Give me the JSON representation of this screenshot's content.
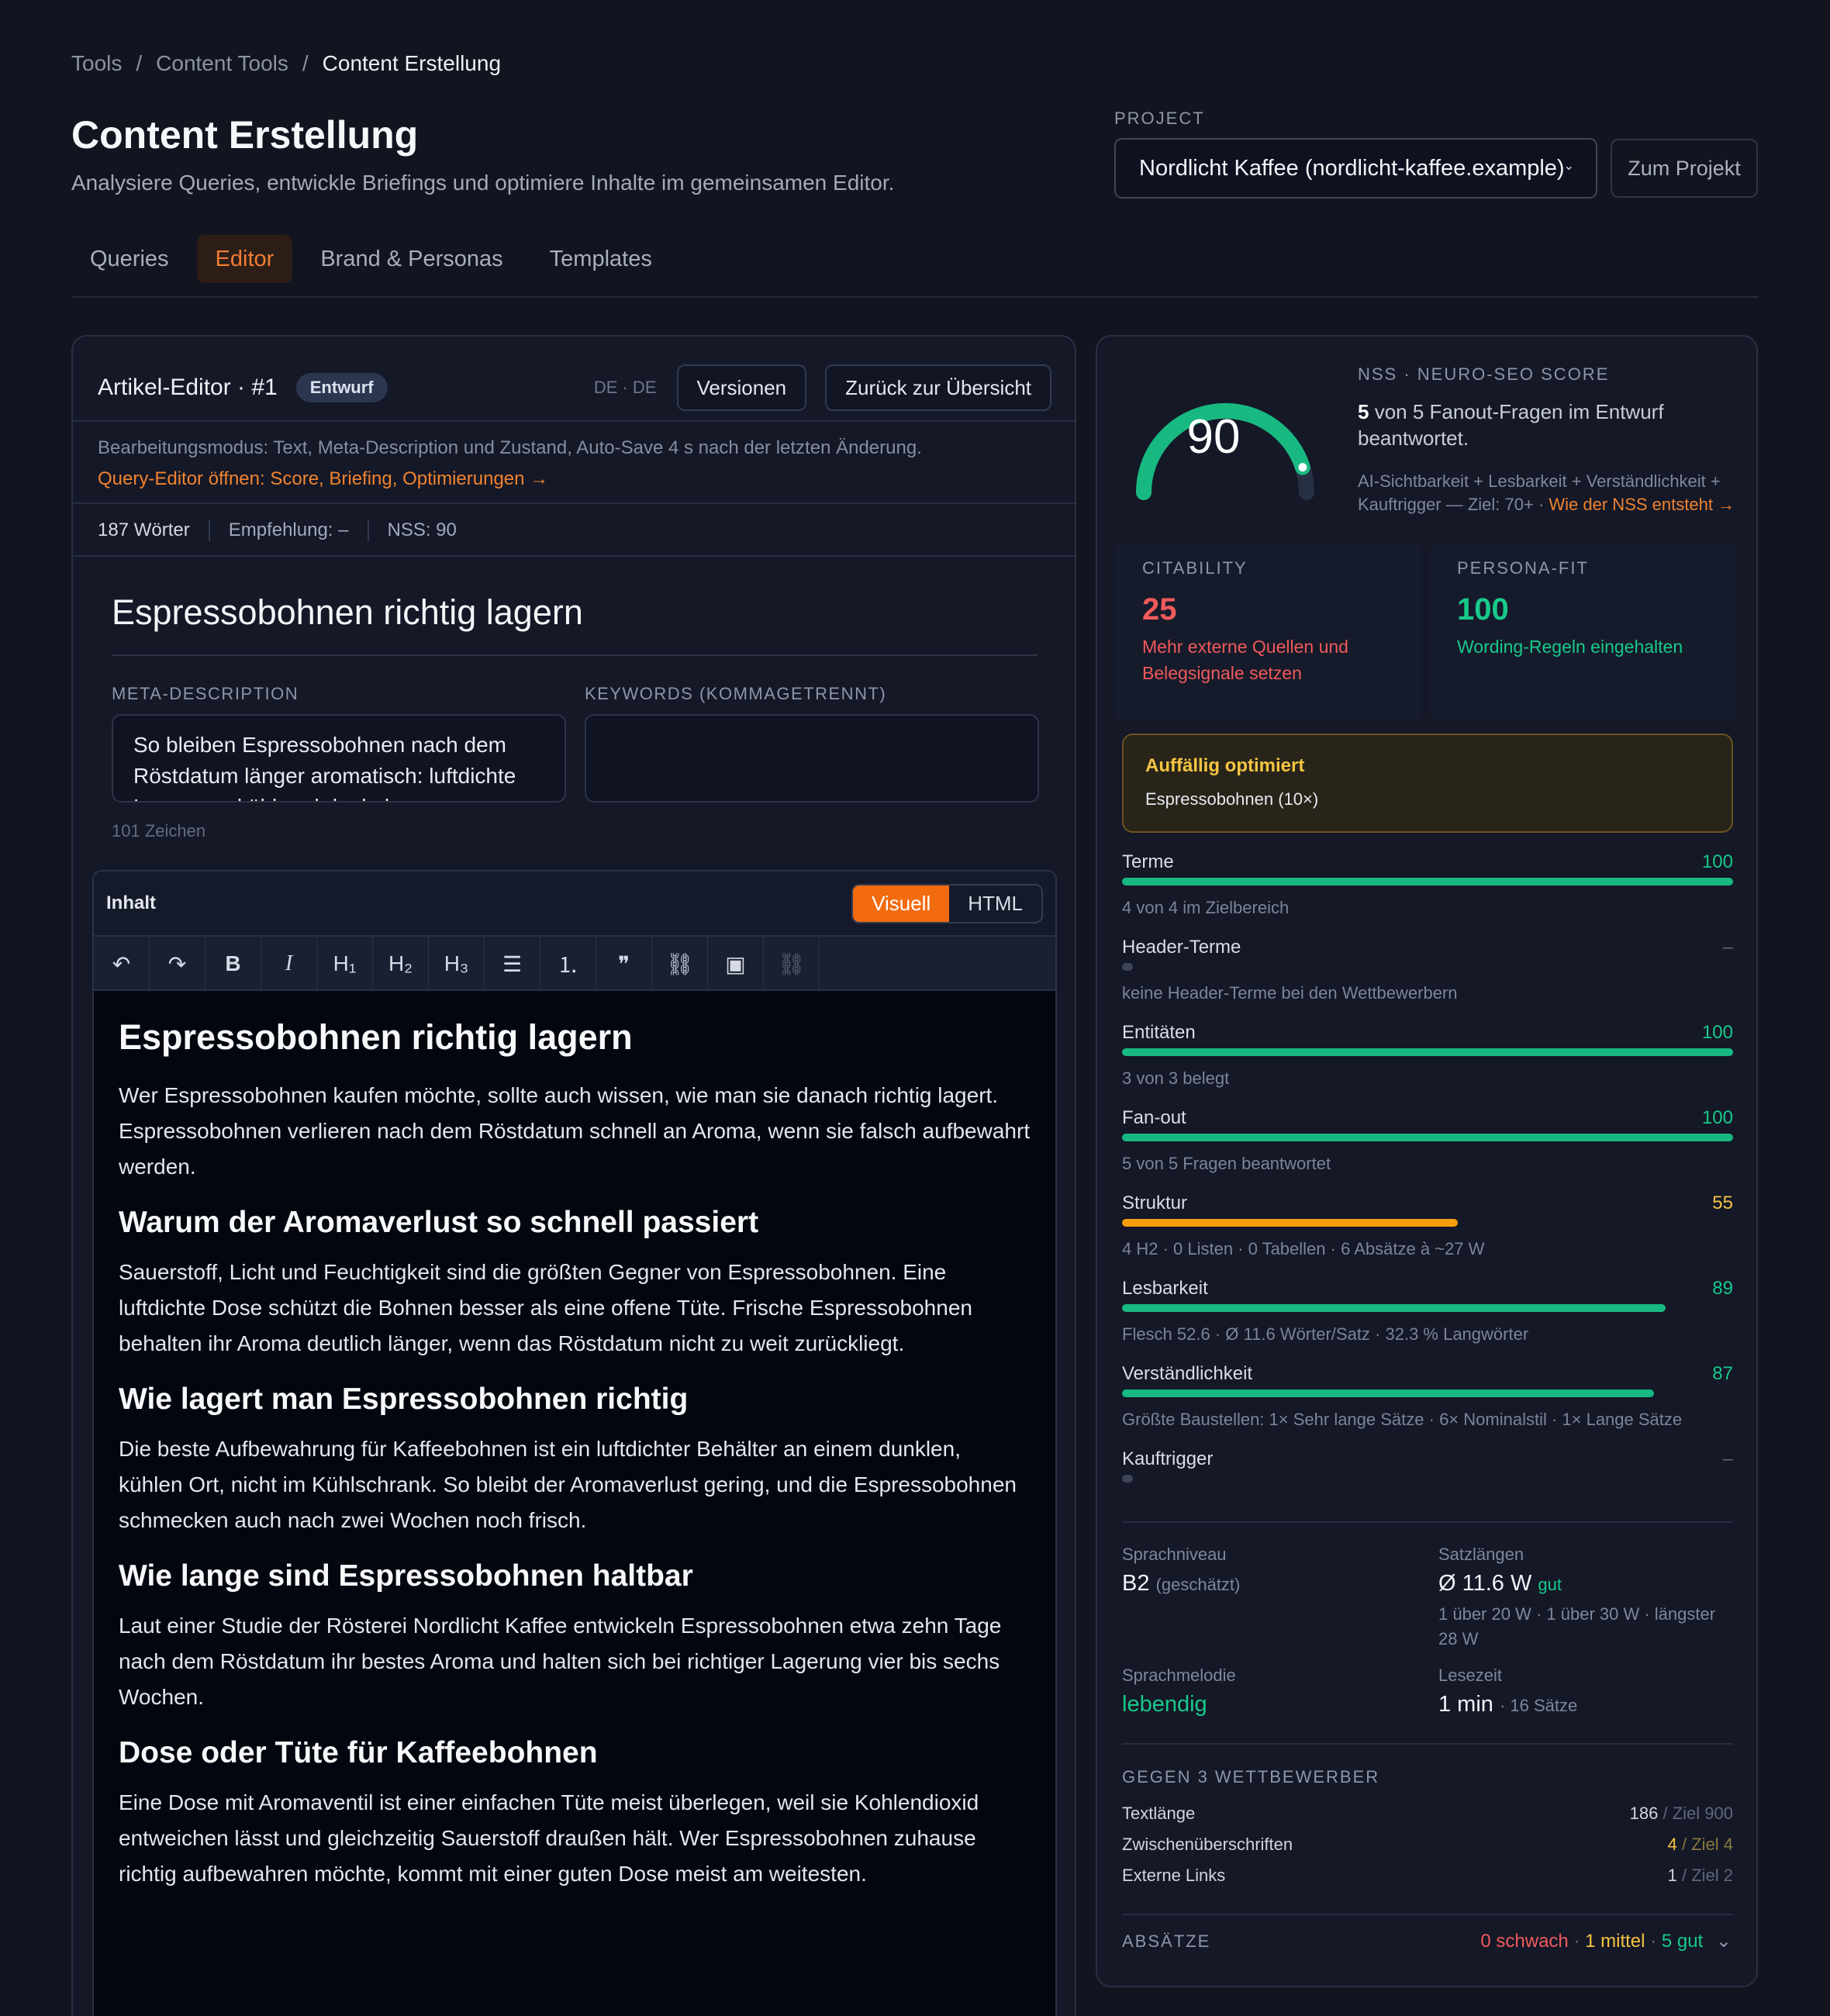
{
  "breadcrumb": {
    "items": [
      "Tools",
      "Content Tools",
      "Content Erstellung"
    ],
    "separator": "/"
  },
  "page": {
    "title": "Content Erstellung",
    "subtitle": "Analysiere Queries, entwickle Briefings und optimiere Inhalte im gemeinsamen Editor."
  },
  "project": {
    "label": "PROJECT",
    "selected": "Nordlicht Kaffee (nordlicht-kaffee.example)",
    "button": "Zum Projekt"
  },
  "tabs": [
    {
      "label": "Queries"
    },
    {
      "label": "Editor",
      "active": true
    },
    {
      "label": "Brand & Personas"
    },
    {
      "label": "Templates"
    }
  ],
  "editor": {
    "title": "Artikel-Editor · #1",
    "status": "Entwurf",
    "lang": "DE · DE",
    "versions_btn": "Versionen",
    "back_btn": "Zurück zur Übersicht",
    "note": "Bearbeitungsmodus: Text, Meta-Description und Zustand, Auto-Save 4 s nach der letzten Änderung.",
    "query_link": "Query-Editor öffnen: Score, Briefing, Optimierungen →",
    "stats": {
      "words": "187 Wörter",
      "recommendation": "Empfehlung: –",
      "nss": "NSS: 90"
    },
    "doc_title": "Espressobohnen richtig lagern",
    "meta_label": "META-DESCRIPTION",
    "meta_value": "So bleiben Espressobohnen nach dem Röstdatum länger aromatisch: luftdichte Lagerung, kühl und dunkel.",
    "keywords_label": "KEYWORDS (KOMMAGETRENNT)",
    "keywords_value": "",
    "char_count": "101 Zeichen",
    "content_label": "Inhalt",
    "mode_visual": "Visuell",
    "mode_html": "HTML",
    "toolbar": {
      "undo": "↶",
      "redo": "↷",
      "bold": "B",
      "italic": "I",
      "h1": "H₁",
      "h2": "H₂",
      "h3": "H₃",
      "ul": "☰",
      "ol": "⒈",
      "quote": "❞",
      "link": "⛓",
      "image": "▣",
      "unlink": "⛓"
    },
    "body": {
      "h1": "Espressobohnen richtig lagern",
      "p1": "Wer Espressobohnen kaufen möchte, sollte auch wissen, wie man sie danach richtig lagert. Espressobohnen verlieren nach dem Röstdatum schnell an Aroma, wenn sie falsch aufbewahrt werden.",
      "h2a": "Warum der Aromaverlust so schnell passiert",
      "p2": "Sauerstoff, Licht und Feuchtigkeit sind die größten Gegner von Espressobohnen. Eine luftdichte Dose schützt die Bohnen besser als eine offene Tüte. Frische Espressobohnen behalten ihr Aroma deutlich länger, wenn das Röstdatum nicht zu weit zurückliegt.",
      "h2b": "Wie lagert man Espressobohnen richtig",
      "p3": "Die beste Aufbewahrung für Kaffeebohnen ist ein luftdichter Behälter an einem dunklen, kühlen Ort, nicht im Kühlschrank. So bleibt der Aromaverlust gering, und die Espressobohnen schmecken auch nach zwei Wochen noch frisch.",
      "h2c": "Wie lange sind Espressobohnen haltbar",
      "p4": "Laut einer Studie der Rösterei Nordlicht Kaffee entwickeln Espressobohnen etwa zehn Tage nach dem Röstdatum ihr bestes Aroma und halten sich bei richtiger Lagerung vier bis sechs Wochen.",
      "h2d": "Dose oder Tüte für Kaffeebohnen",
      "p5": "Eine Dose mit Aromaventil ist einer einfachen Tüte meist überlegen, weil sie Kohlendioxid entweichen lässt und gleichzeitig Sauerstoff draußen hält. Wer Espressobohnen zuhause richtig aufbewahren möchte, kommt mit einer guten Dose meist am weitesten."
    }
  },
  "score": {
    "value": 90,
    "label": "NSS · NEURO-SEO SCORE",
    "fanout_count": "5",
    "fanout_text": "von 5 Fanout-Fragen im Entwurf beantwortet.",
    "formula": "AI-Sichtbarkeit + Lesbarkeit + Verständlichkeit + Kauftrigger — Ziel: 70+ · ",
    "formula_link": "Wie der NSS entsteht →",
    "citability": {
      "label": "CITABILITY",
      "value": "25",
      "desc": "Mehr externe Quellen und Belegsignale setzen"
    },
    "persona": {
      "label": "PERSONA-FIT",
      "value": "100",
      "desc": "Wording-Regeln eingehalten"
    },
    "warning": {
      "title": "Auffällig optimiert",
      "detail": "Espressobohnen (10×)"
    },
    "metrics": [
      {
        "name": "Terme",
        "score": "100",
        "value": 100,
        "sub": "4 von 4 im Zielbereich",
        "color": "#18b981"
      },
      {
        "name": "Header-Terme",
        "score": "–",
        "value": null,
        "sub": "keine Header-Terme bei den Wettbewerbern",
        "color": "#3d4558"
      },
      {
        "name": "Entitäten",
        "score": "100",
        "value": 100,
        "sub": "3 von 3 belegt",
        "color": "#18b981"
      },
      {
        "name": "Fan-out",
        "score": "100",
        "value": 100,
        "sub": "5 von 5 Fragen beantwortet",
        "color": "#18b981"
      },
      {
        "name": "Struktur",
        "score": "55",
        "value": 55,
        "sub": "4 H2 · 0 Listen · 0 Tabellen · 6 Absätze à ~27 W",
        "color": "#f59e0b"
      },
      {
        "name": "Lesbarkeit",
        "score": "89",
        "value": 89,
        "sub": "Flesch 52.6 · Ø 11.6 Wörter/Satz · 32.3 % Langwörter",
        "color": "#18b981"
      },
      {
        "name": "Verständlichkeit",
        "score": "87",
        "value": 87,
        "sub": "Größte Baustellen: 1× Sehr lange Sätze · 6× Nominalstil · 1× Lange Sätze",
        "color": "#18b981"
      },
      {
        "name": "Kauftrigger",
        "score": "–",
        "value": null,
        "sub": "",
        "color": "#3d4558"
      }
    ],
    "sprachniveau": {
      "label": "Sprachniveau",
      "value": "B2",
      "note": "(geschätzt)"
    },
    "satzlaengen": {
      "label": "Satzlängen",
      "value": "Ø 11.6 W",
      "tag": "gut",
      "detail": "1 über 20 W · 1 über 30 W · längster 28 W"
    },
    "sprachmelodie": {
      "label": "Sprachmelodie",
      "value": "lebendig"
    },
    "lesezeit": {
      "label": "Lesezeit",
      "value": "1 min",
      "detail": "· 16 Sätze"
    },
    "competitors": {
      "title": "GEGEN 3 WETTBEWERBER",
      "rows": [
        {
          "name": "Textlänge",
          "value": "186",
          "target": "/ Ziel 900",
          "color": "#d0d5df"
        },
        {
          "name": "Zwischenüberschriften",
          "value": "4",
          "target": "/ Ziel 4",
          "color": "#f5c542"
        },
        {
          "name": "Externe Links",
          "value": "1",
          "target": "/ Ziel 2",
          "color": "#d0d5df"
        }
      ]
    },
    "absaetze": {
      "label": "ABSÄTZE",
      "schwach": "0 schwach",
      "mittel": "1 mittel",
      "gut": "5 gut"
    }
  }
}
